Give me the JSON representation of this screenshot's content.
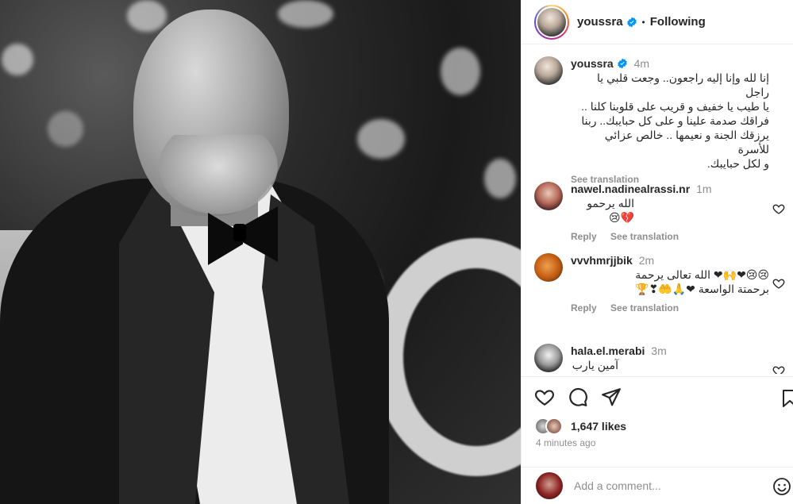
{
  "post": {
    "author": "youssra",
    "follow_status": "Following",
    "dot": "•",
    "photo_label": "post-image"
  },
  "caption": {
    "author": "youssra",
    "time": "4m",
    "lines": [
      "إنا لله وإنا إليه راجعون.. وجعت قلبي يا راجل",
      "يا طيب يا خفيف و قريب على قلوبنا كلنا ..",
      "فراقك صدمة علينا و على كل حبايبك.. ربنا",
      "يرزقك الجنة و نعيمها .. خالص عزائي للأسرة",
      "و لكل حبايبك."
    ],
    "see_translation": "See translation"
  },
  "comments": [
    {
      "user": "nawel.nadinealrassi.nr",
      "time": "1m",
      "text_lines": [
        "الله يرحمو 💔😢"
      ],
      "reply": "Reply",
      "see_translation": "See translation"
    },
    {
      "user": "vvvhmrjjbik",
      "time": "2m",
      "text_lines": [
        "😢😢❤🙌❤ الله تعالى يرحمة",
        "برحمتة الواسعة ❤🙏🤲❣🏆"
      ],
      "reply": "Reply",
      "see_translation": "See translation"
    },
    {
      "user": "hala.el.merabi",
      "time": "3m",
      "text_lines": [
        "آمين يارب 🙏"
      ]
    }
  ],
  "actions": {
    "likes": "1,647 likes",
    "posted": "4 minutes ago"
  },
  "add_comment": {
    "placeholder": "Add a comment..."
  },
  "colors": {
    "text": "#262626",
    "secondary": "#8e8e8e",
    "verified": "#0095f6",
    "border": "#efefef"
  }
}
